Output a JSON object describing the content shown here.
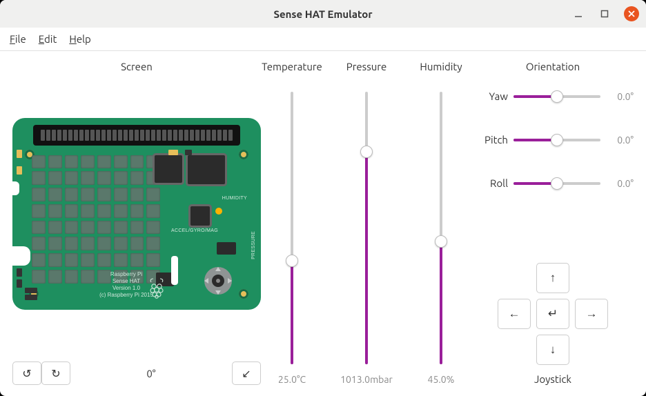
{
  "window": {
    "title": "Sense HAT Emulator"
  },
  "menu": {
    "file": "File",
    "edit": "Edit",
    "help": "Help"
  },
  "screen": {
    "title": "Screen",
    "rotation": "0°",
    "board": {
      "line1": "Raspberry Pi",
      "line2": "Sense HAT",
      "line3": "Version 1.0",
      "line4": "(c) Raspberry Pi 2015",
      "label_humidity": "HUMIDITY",
      "label_pressure": "PRESSURE",
      "label_imu": "ACCEL/GYRO/MAG"
    }
  },
  "sensors": {
    "temperature": {
      "title": "Temperature",
      "value": "25.0°C",
      "percent": 38
    },
    "pressure": {
      "title": "Pressure",
      "value": "1013.0mbar",
      "percent": 78
    },
    "humidity": {
      "title": "Humidity",
      "value": "45.0%",
      "percent": 45
    }
  },
  "orientation": {
    "title": "Orientation",
    "yaw": {
      "label": "Yaw",
      "value": "0.0°",
      "percent": 50
    },
    "pitch": {
      "label": "Pitch",
      "value": "0.0°",
      "percent": 50
    },
    "roll": {
      "label": "Roll",
      "value": "0.0°",
      "percent": 50
    }
  },
  "joystick": {
    "title": "Joystick"
  }
}
